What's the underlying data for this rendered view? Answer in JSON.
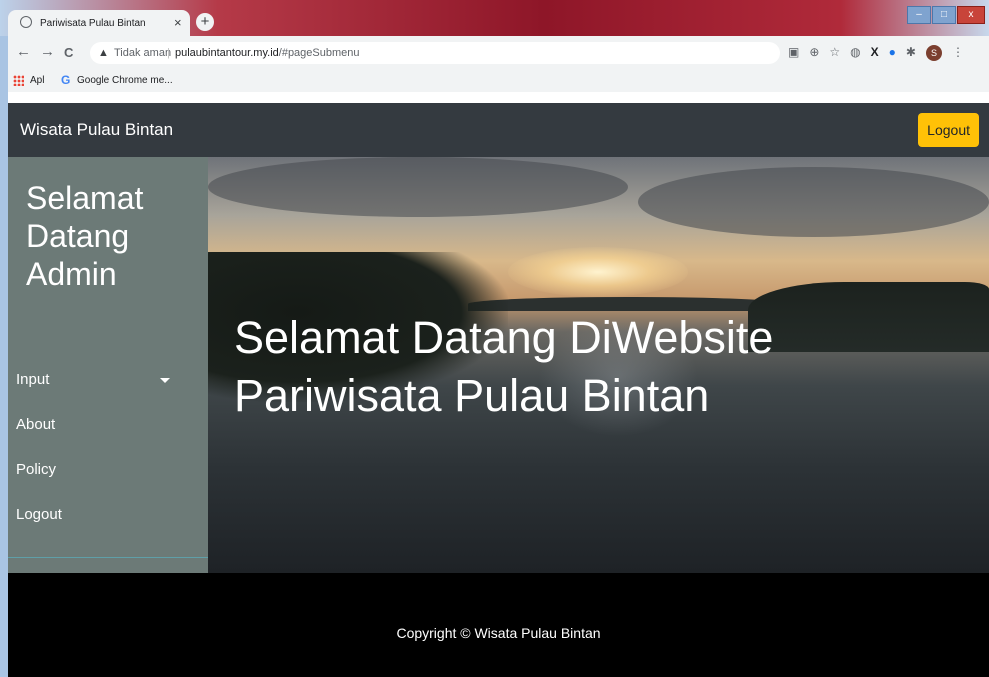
{
  "browser": {
    "tab_title": "Pariwisata Pulau Bintan",
    "tab_close": "×",
    "new_tab": "+",
    "nav": {
      "back": "←",
      "forward": "→",
      "reload": "C"
    },
    "security_label": "Tidak aman",
    "url_host": "pulaubintantour.my.id",
    "url_path": "/#pageSubmenu",
    "bookmarks": [
      {
        "icon": "apps-grid-icon",
        "label": "Apl"
      },
      {
        "icon": "google-icon",
        "label": "Google Chrome me..."
      }
    ],
    "profile_initial": "S"
  },
  "navbar": {
    "brand": "Wisata Pulau Bintan",
    "logout_label": "Logout",
    "logout_color": "#ffc107",
    "background": "#343a40"
  },
  "sidebar": {
    "welcome": "Selamat Datang Admin",
    "items": [
      {
        "label": "Input",
        "has_dropdown": true
      },
      {
        "label": "About"
      },
      {
        "label": "Policy"
      },
      {
        "label": "Logout"
      }
    ],
    "background": "#6c7a77"
  },
  "hero": {
    "title_line1": "Selamat Datang DiWebsite",
    "title_line2": "Pariwisata Pulau Bintan"
  },
  "footer": {
    "copyright": "Copyright © Wisata Pulau Bintan"
  }
}
